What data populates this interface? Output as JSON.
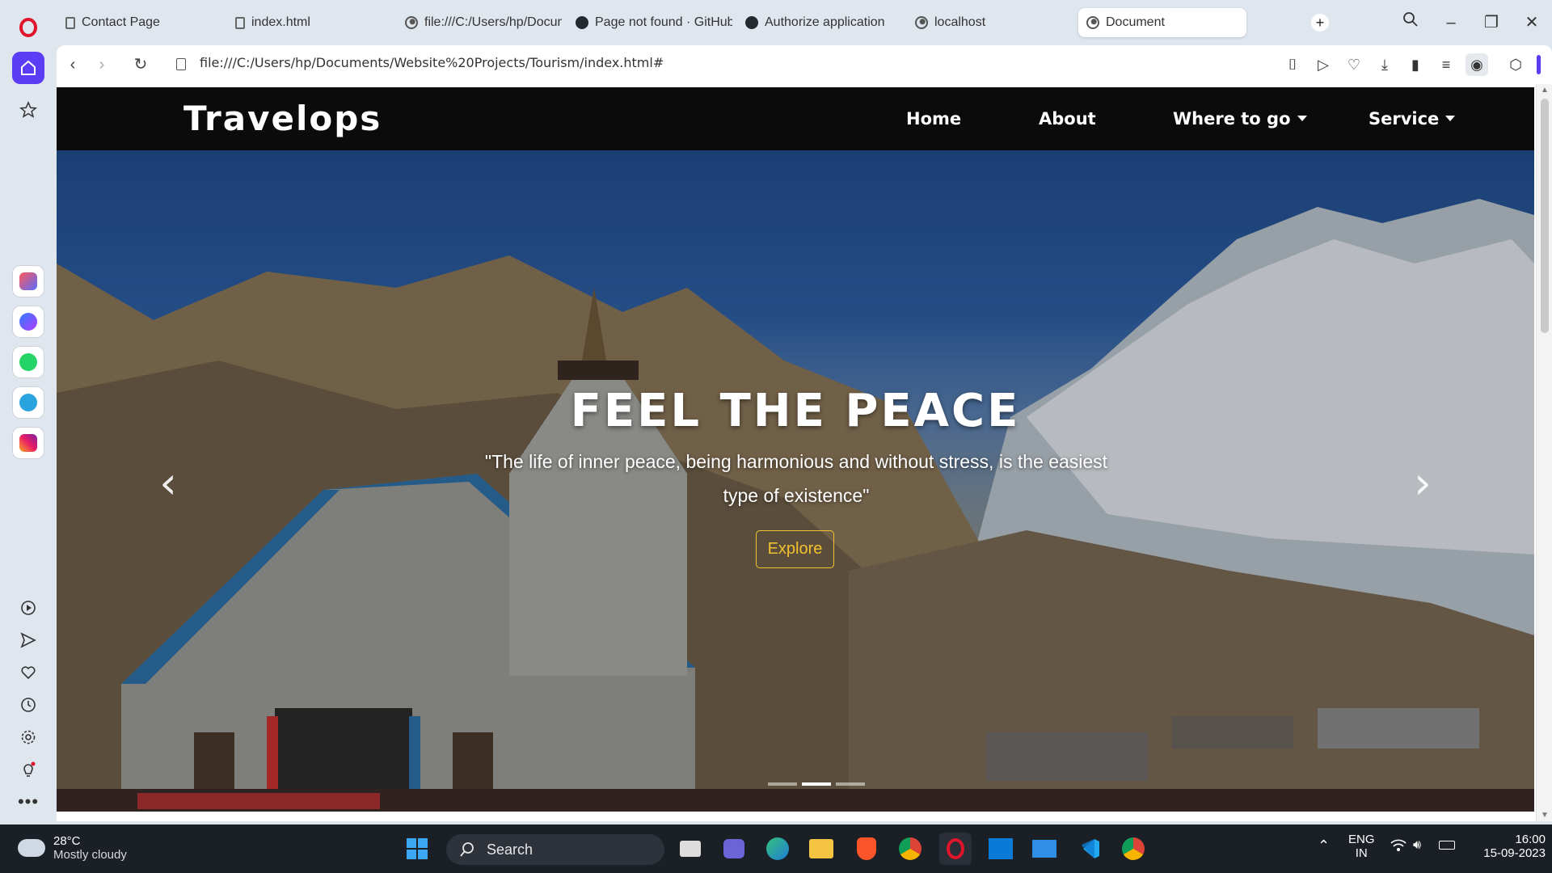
{
  "browser": {
    "tabs": [
      {
        "label": "Contact Page",
        "icon": "document-icon",
        "active": false
      },
      {
        "label": "index.html",
        "icon": "document-icon",
        "active": false
      },
      {
        "label": "file:///C:/Users/hp/Docum",
        "icon": "globe-icon",
        "active": false
      },
      {
        "label": "Page not found · GitHub",
        "icon": "github-icon",
        "active": false
      },
      {
        "label": "Authorize application",
        "icon": "github-icon",
        "active": false
      },
      {
        "label": "localhost",
        "icon": "globe-icon",
        "active": false
      },
      {
        "label": "Document",
        "icon": "globe-icon",
        "active": true
      }
    ],
    "url": "file:///C:/Users/hp/Documents/Website%20Projects/Tourism/index.html#"
  },
  "site": {
    "brand": "Travelops",
    "nav": [
      {
        "label": "Home",
        "dropdown": false
      },
      {
        "label": "About",
        "dropdown": false
      },
      {
        "label": "Where to go",
        "dropdown": true
      },
      {
        "label": "Service",
        "dropdown": true
      }
    ]
  },
  "hero": {
    "title": "FEEL THE PEACE",
    "quote": "\"The life of inner peace, being harmonious and without stress, is the easiest type of existence\"",
    "button": "Explore",
    "slides": 3,
    "active_slide": 2,
    "accent": "#f2c12e"
  },
  "taskbar": {
    "weather_temp": "28°C",
    "weather_desc": "Mostly cloudy",
    "search_label": "Search",
    "lang_line1": "ENG",
    "lang_line2": "IN",
    "time": "16:00",
    "date": "15-09-2023"
  }
}
